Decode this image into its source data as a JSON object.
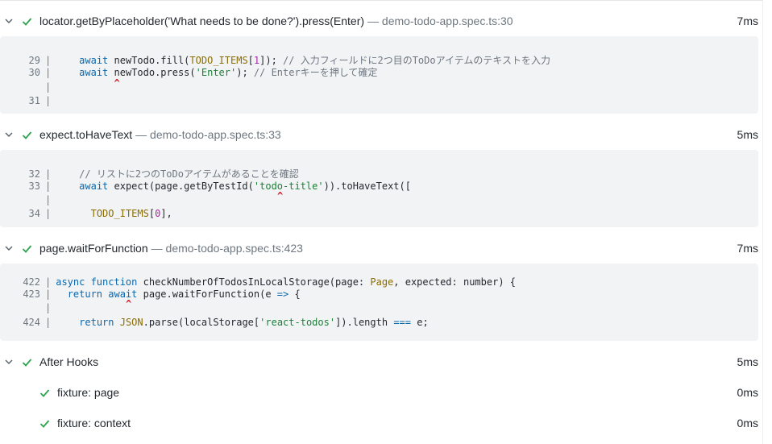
{
  "steps": [
    {
      "title": "locator.getByPlaceholder('What needs to be done?').press(Enter)",
      "location": "— demo-todo-app.spec.ts:30",
      "duration": "7ms",
      "snippet": [
        {
          "num": "29",
          "parts": [
            {
              "t": "    ",
              "c": ""
            },
            {
              "t": "await",
              "c": "k"
            },
            {
              "t": " newTodo.fill(",
              "c": ""
            },
            {
              "t": "TODO_ITEMS",
              "c": "t"
            },
            {
              "t": "[",
              "c": ""
            },
            {
              "t": "1",
              "c": "n"
            },
            {
              "t": "]); ",
              "c": ""
            },
            {
              "t": "// 入力フィールドに2つ目のToDoアイテムのテキストを入力",
              "c": "c"
            }
          ]
        },
        {
          "num": "30",
          "parts": [
            {
              "t": "    ",
              "c": ""
            },
            {
              "t": "await",
              "c": "k"
            },
            {
              "t": " newTodo.press(",
              "c": ""
            },
            {
              "t": "'Enter'",
              "c": "s"
            },
            {
              "t": "); ",
              "c": ""
            },
            {
              "t": "// Enterキーを押して確定",
              "c": "c"
            }
          ]
        },
        {
          "num": "",
          "parts": []
        },
        {
          "num": "31",
          "parts": []
        }
      ]
    },
    {
      "title": "expect.toHaveText",
      "location": "— demo-todo-app.spec.ts:33",
      "duration": "5ms",
      "snippet": [
        {
          "num": "32",
          "parts": [
            {
              "t": "    ",
              "c": ""
            },
            {
              "t": "// リストに2つのToDoアイテムがあることを確認",
              "c": "c"
            }
          ]
        },
        {
          "num": "33",
          "parts": [
            {
              "t": "    ",
              "c": ""
            },
            {
              "t": "await",
              "c": "k"
            },
            {
              "t": " expect(page.getByTestId(",
              "c": ""
            },
            {
              "t": "'todo-title'",
              "c": "s"
            },
            {
              "t": ")).toHaveText([",
              "c": ""
            }
          ]
        },
        {
          "num": "",
          "parts": []
        },
        {
          "num": "34",
          "parts": [
            {
              "t": "      ",
              "c": ""
            },
            {
              "t": "TODO_ITEMS",
              "c": "t"
            },
            {
              "t": "[",
              "c": ""
            },
            {
              "t": "0",
              "c": "n"
            },
            {
              "t": "],",
              "c": ""
            }
          ]
        }
      ]
    },
    {
      "title": "page.waitForFunction",
      "location": "— demo-todo-app.spec.ts:423",
      "duration": "7ms",
      "snippet": [
        {
          "num": "422",
          "parts": [
            {
              "t": "async function",
              "c": "k"
            },
            {
              "t": " checkNumberOfTodosInLocalStorage(page: ",
              "c": ""
            },
            {
              "t": "Page",
              "c": "t"
            },
            {
              "t": ", expected: number) {",
              "c": ""
            }
          ]
        },
        {
          "num": "423",
          "parts": [
            {
              "t": "  ",
              "c": ""
            },
            {
              "t": "return await",
              "c": "k"
            },
            {
              "t": " page.waitForFunction(e ",
              "c": ""
            },
            {
              "t": "=>",
              "c": "k"
            },
            {
              "t": " {",
              "c": ""
            }
          ]
        },
        {
          "num": "",
          "parts": []
        },
        {
          "num": "424",
          "parts": [
            {
              "t": "    ",
              "c": ""
            },
            {
              "t": "return",
              "c": "k"
            },
            {
              "t": " ",
              "c": ""
            },
            {
              "t": "JSON",
              "c": "t"
            },
            {
              "t": ".parse(localStorage[",
              "c": ""
            },
            {
              "t": "'react-todos'",
              "c": "s"
            },
            {
              "t": "]).length ",
              "c": ""
            },
            {
              "t": "===",
              "c": "k"
            },
            {
              "t": " e;",
              "c": ""
            }
          ]
        }
      ]
    },
    {
      "title": "After Hooks",
      "location": "",
      "duration": "5ms"
    }
  ],
  "substeps": [
    {
      "title": "fixture: page",
      "duration": "0ms"
    },
    {
      "title": "fixture: context",
      "duration": "0ms"
    }
  ],
  "caret_glyph": "^",
  "pipe_glyph": "|",
  "colors": {
    "check": "#2da44e",
    "caret": "#cf222e",
    "keyword": "#0b68ad",
    "string": "#1a7f37",
    "comment": "#6e7781",
    "snippet_bg": "#f2f3f5"
  }
}
